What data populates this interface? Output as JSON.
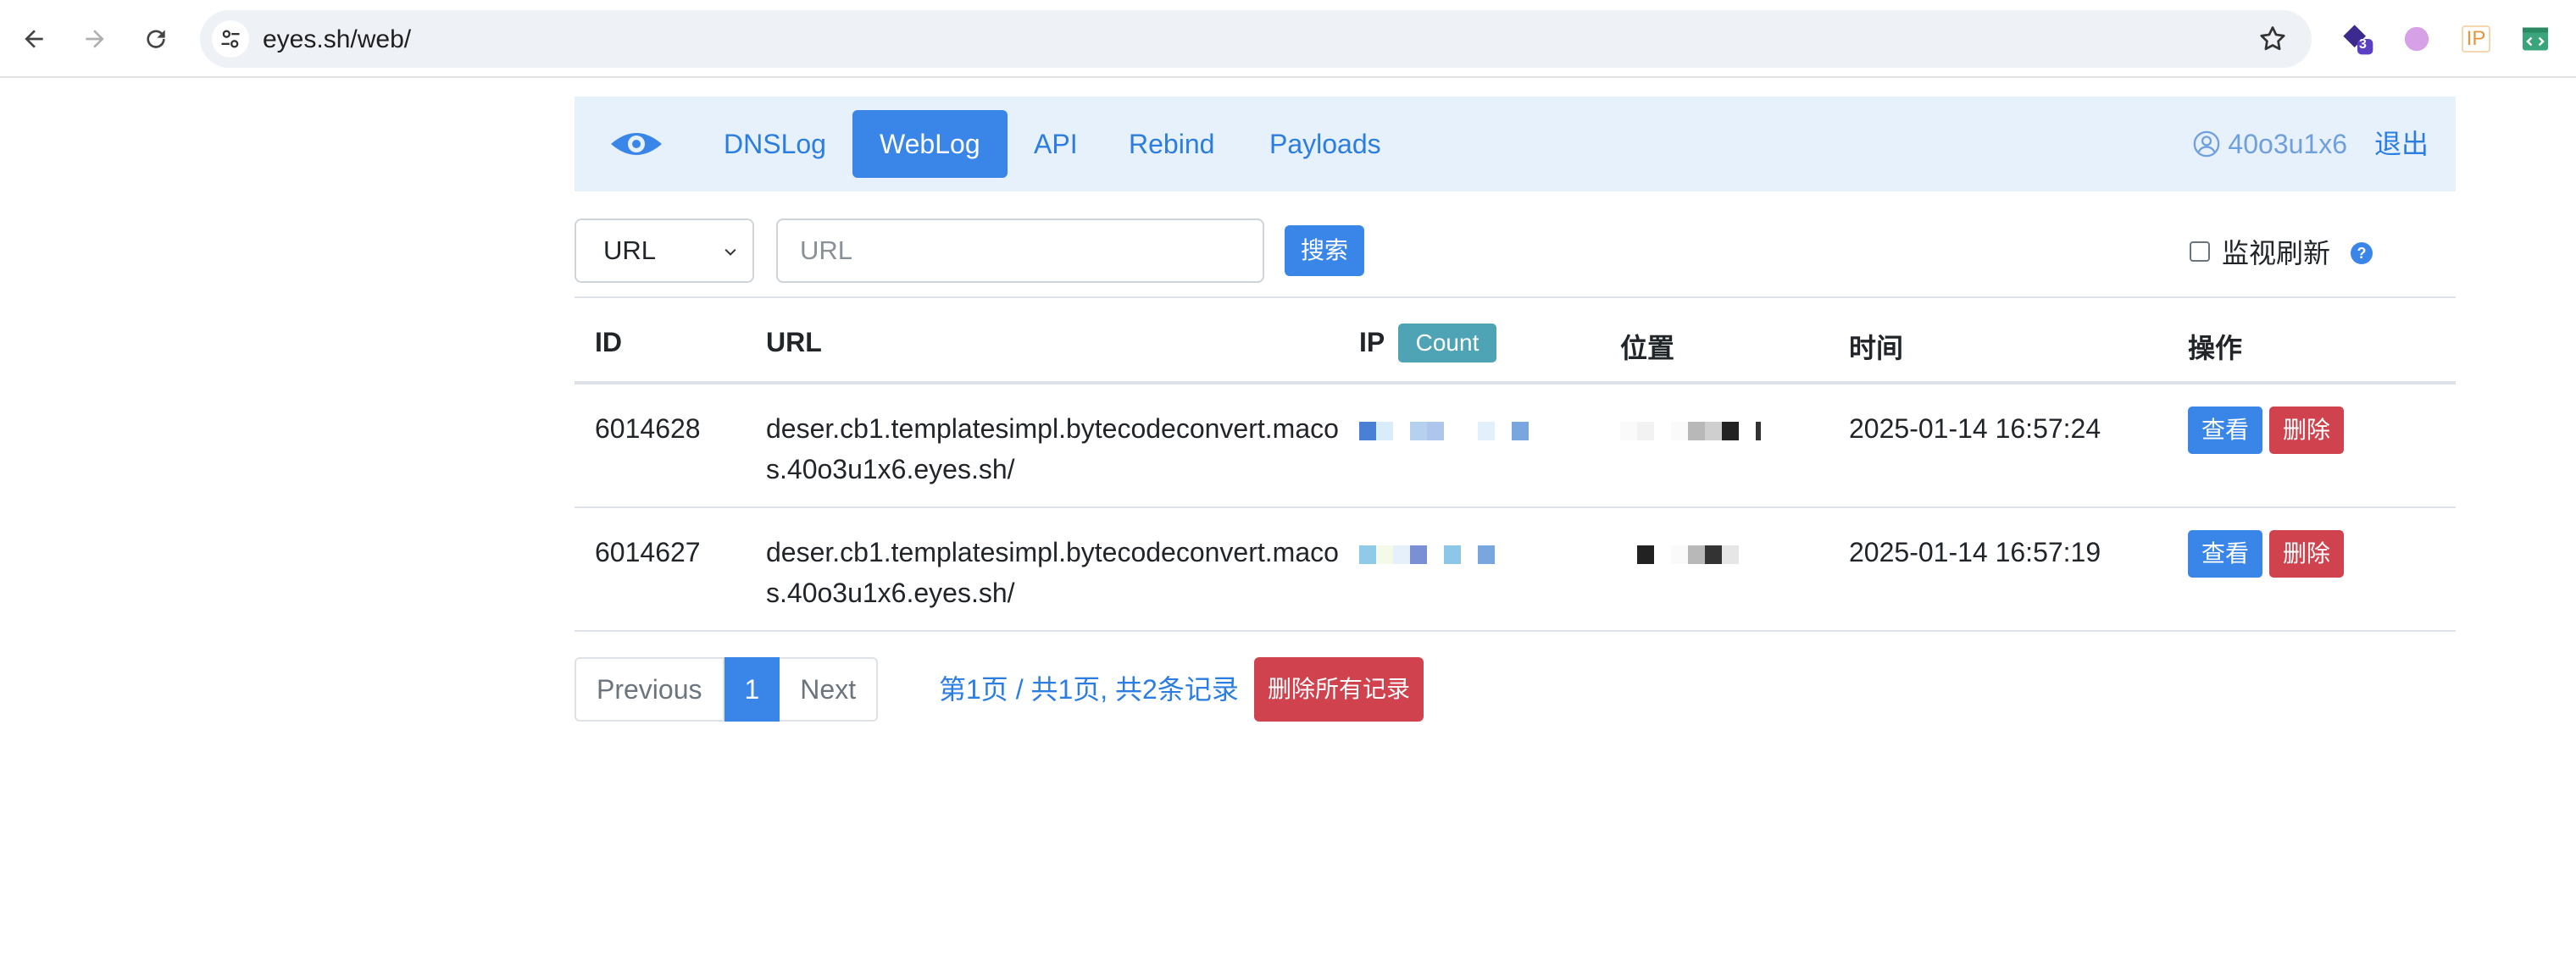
{
  "browser": {
    "url": "eyes.sh/web/",
    "extension_badge_count": "3",
    "ip_extension_label": "IP"
  },
  "navbar": {
    "links": [
      "DNSLog",
      "WebLog",
      "API",
      "Rebind",
      "Payloads"
    ],
    "active": "WebLog",
    "username": "40o3u1x6",
    "logout_label": "退出"
  },
  "search": {
    "select_value": "URL",
    "input_placeholder": "URL",
    "button_label": "搜索",
    "monitor_label": "监视刷新",
    "help_label": "?"
  },
  "table": {
    "headers": {
      "id": "ID",
      "url": "URL",
      "ip": "IP",
      "count_badge": "Count",
      "location": "位置",
      "time": "时间",
      "actions": "操作"
    },
    "rows": [
      {
        "id": "6014628",
        "url": "deser.cb1.templatesimpl.bytecodeconvert.macos.40o3u1x6.eyes.sh/",
        "time": "2025-01-14 16:57:24",
        "view_label": "查看",
        "delete_label": "删除"
      },
      {
        "id": "6014627",
        "url": "deser.cb1.templatesimpl.bytecodeconvert.macos.40o3u1x6.eyes.sh/",
        "time": "2025-01-14 16:57:19",
        "view_label": "查看",
        "delete_label": "删除"
      }
    ]
  },
  "pagination": {
    "previous_label": "Previous",
    "current_page": "1",
    "next_label": "Next",
    "info": "第1页 / 共1页, 共2条记录",
    "delete_all_label": "删除所有记录"
  },
  "colors": {
    "primary": "#3a86e8",
    "danger": "#d0424d",
    "info_badge": "#4ea3b5",
    "navbar_bg": "#e7f1fb"
  }
}
